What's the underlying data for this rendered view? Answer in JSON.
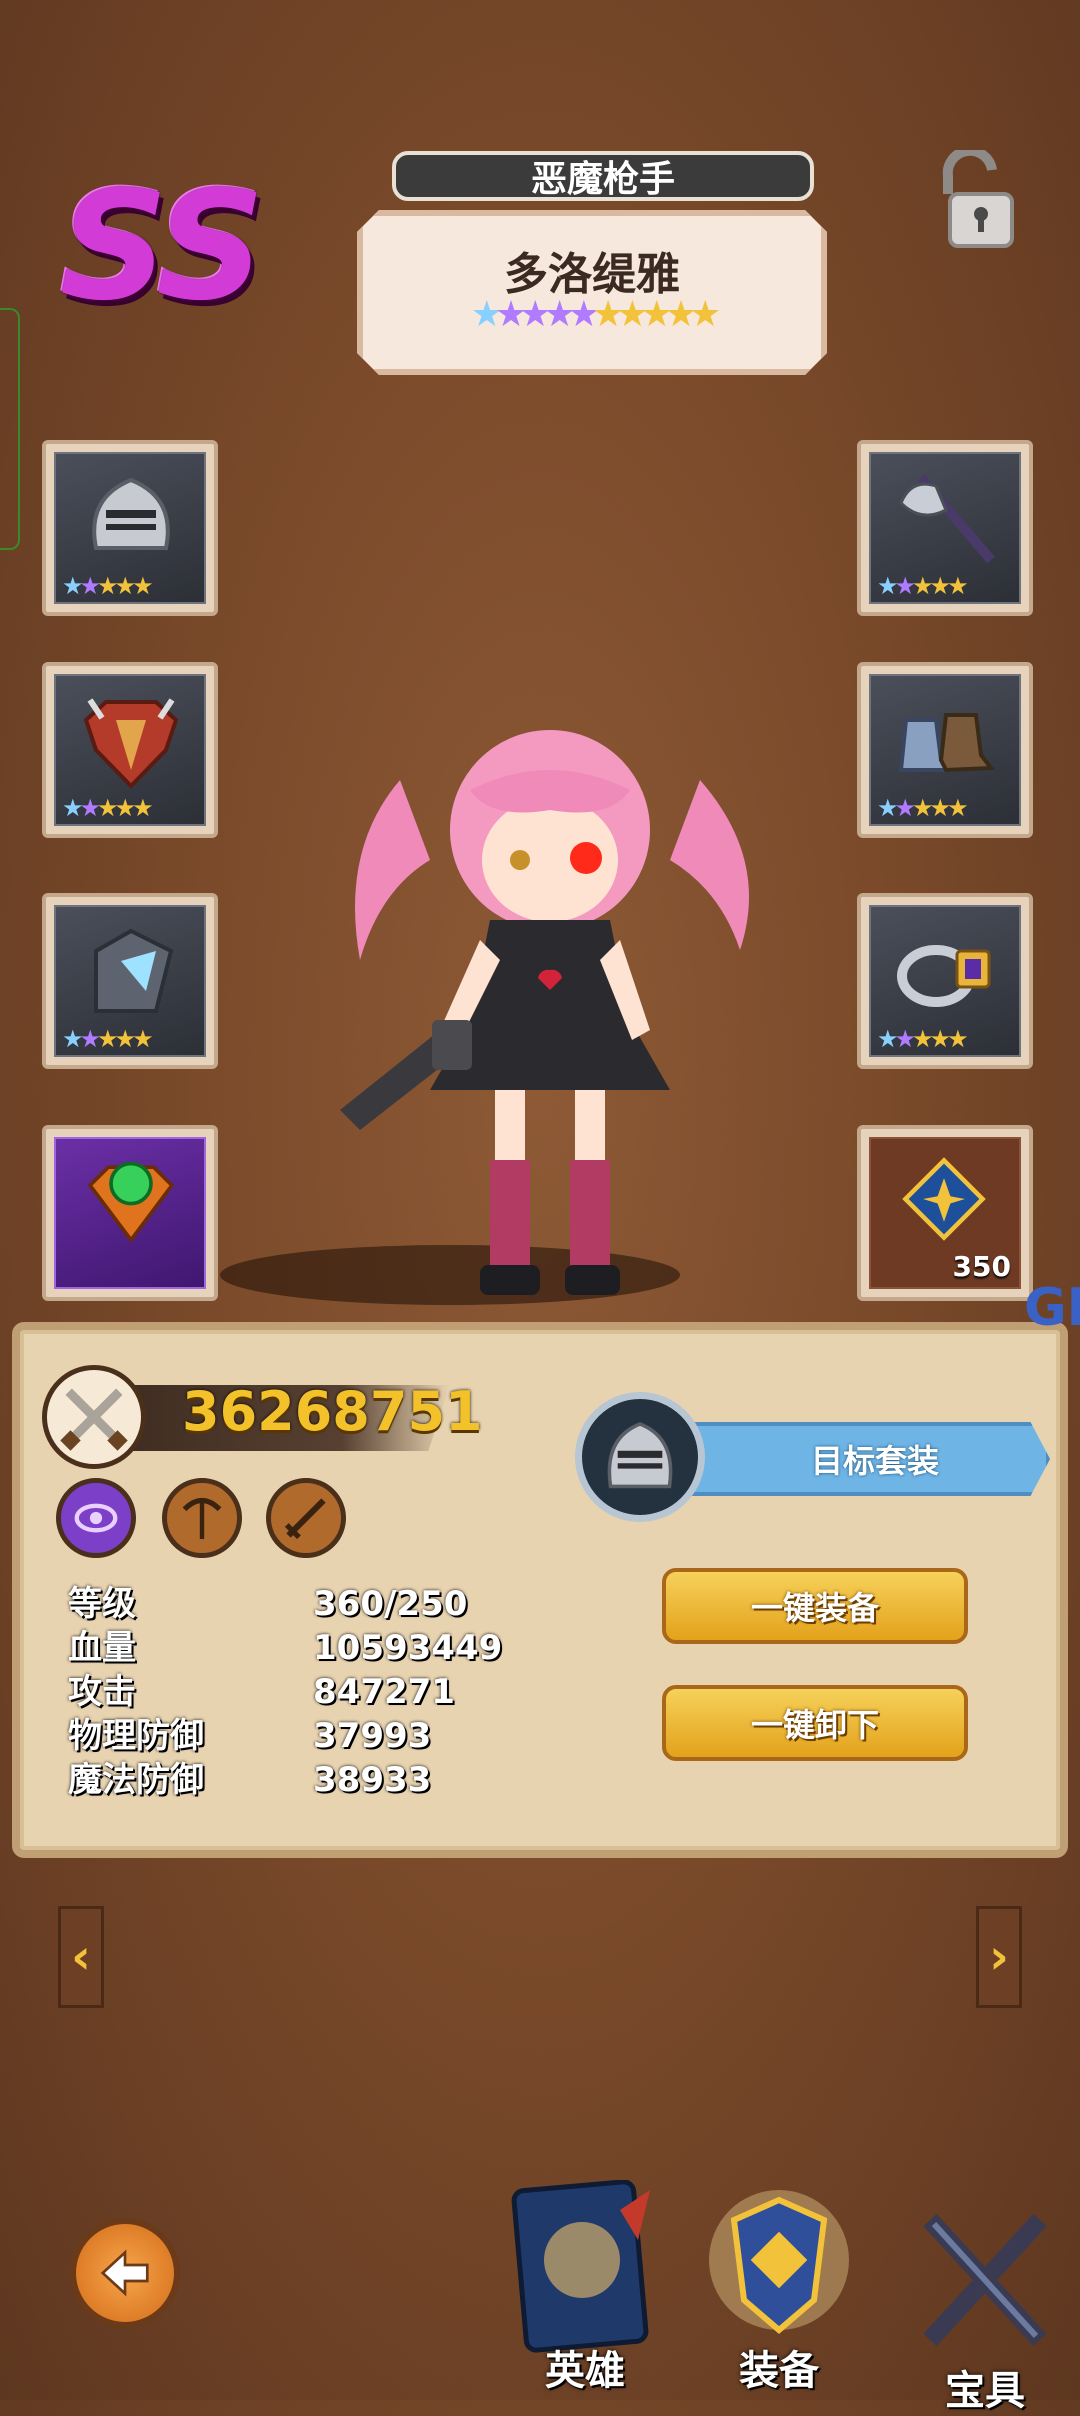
{
  "rank": "SS",
  "hero": {
    "class": "恶魔枪手",
    "name": "多洛缇雅",
    "stars": "★★★★★★★★★★"
  },
  "equipment": {
    "left": [
      {
        "name": "helmet",
        "stars": "★★★★★"
      },
      {
        "name": "chest-armor",
        "stars": "★★★★★"
      },
      {
        "name": "gauntlet",
        "stars": "★★★★★"
      },
      {
        "name": "emblem"
      }
    ],
    "right": [
      {
        "name": "axe",
        "stars": "★★★★★"
      },
      {
        "name": "boots",
        "stars": "★★★★★"
      },
      {
        "name": "ring",
        "stars": "★★★★★"
      },
      {
        "name": "crest",
        "count": "350"
      }
    ]
  },
  "power": "36268751",
  "stats": [
    {
      "label": "等级",
      "value": "360/250"
    },
    {
      "label": "血量",
      "value": "10593449"
    },
    {
      "label": "攻击",
      "value": "847271"
    },
    {
      "label": "物理防御",
      "value": "37993"
    },
    {
      "label": "魔法防御",
      "value": "38933"
    }
  ],
  "buttons": {
    "target_set": "目标套装",
    "equip_all": "一键装备",
    "unequip_all": "一键卸下"
  },
  "watermark": "GK",
  "nav": [
    {
      "label": "英雄"
    },
    {
      "label": "装备"
    },
    {
      "label": "宝具"
    }
  ],
  "colors": {
    "rank": "#d33bd6",
    "power": "#f3c22a",
    "accent_blue": "#6eb5e6",
    "gold_button": "#e3a21b"
  }
}
